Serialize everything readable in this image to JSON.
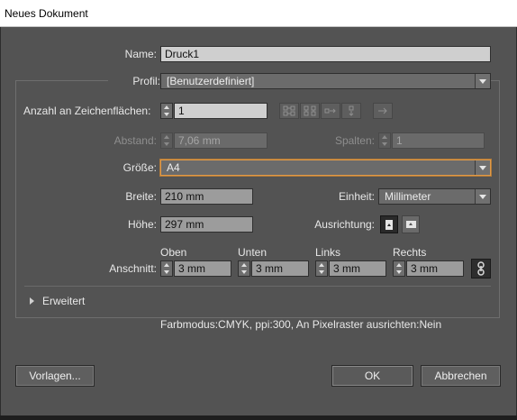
{
  "window": {
    "title": "Neues Dokument"
  },
  "name": {
    "label": "Name:",
    "value": "Druck1"
  },
  "profile": {
    "label": "Profil:",
    "value": "[Benutzerdefiniert]"
  },
  "artboards": {
    "label": "Anzahl an Zeichenflächen:",
    "value": "1"
  },
  "spacing": {
    "label": "Abstand:",
    "value": "7,06 mm"
  },
  "columns": {
    "label": "Spalten:",
    "value": "1"
  },
  "size": {
    "label": "Größe:",
    "value": "A4"
  },
  "width": {
    "label": "Breite:",
    "value": "210 mm"
  },
  "units": {
    "label": "Einheit:",
    "value": "Millimeter"
  },
  "height": {
    "label": "Höhe:",
    "value": "297 mm"
  },
  "orientation": {
    "label": "Ausrichtung:",
    "selected": "portrait"
  },
  "bleed": {
    "label": "Anschnitt:",
    "top": {
      "label": "Oben",
      "value": "3 mm"
    },
    "bottom": {
      "label": "Unten",
      "value": "3 mm"
    },
    "left": {
      "label": "Links",
      "value": "3 mm"
    },
    "right": {
      "label": "Rechts",
      "value": "3 mm"
    }
  },
  "advanced": {
    "label": "Erweitert",
    "expanded": false
  },
  "info": {
    "text": "Farbmodus:CMYK, ppi:300, An Pixelraster ausrichten:Nein"
  },
  "buttons": {
    "templates": "Vorlagen...",
    "ok": "OK",
    "cancel": "Abbrechen"
  },
  "icons": {
    "grid_by_row": "grid-by-row-icon",
    "grid_by_column": "grid-by-column-icon",
    "arrange_by_row": "arrange-by-row-icon",
    "arrange_by_column": "arrange-by-column-icon",
    "layout_direction": "layout-direction-icon",
    "portrait": "portrait-orientation-icon",
    "landscape": "landscape-orientation-icon",
    "link": "link-chain-icon",
    "expand": "expand-triangle-icon"
  },
  "colors": {
    "focus_border": "#e29a47",
    "dialog_bg": "#535353",
    "field_bg": "#9c9c9c"
  }
}
